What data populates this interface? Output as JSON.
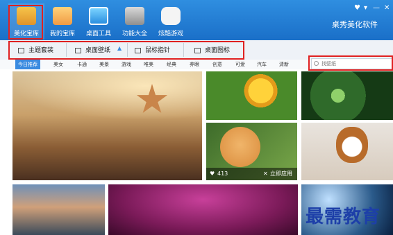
{
  "nav": [
    {
      "label": "美化宝库",
      "icon": "treasure-chest-icon",
      "active": true
    },
    {
      "label": "我的宝库",
      "icon": "store-icon"
    },
    {
      "label": "桌面工具",
      "icon": "desktop-tools-icon"
    },
    {
      "label": "功能大全",
      "icon": "toolbox-icon"
    },
    {
      "label": "炫酷游戏",
      "icon": "gamepad-icon"
    }
  ],
  "brand": "桌秀美化软件",
  "window_controls": [
    "♥",
    "▾",
    "—",
    "✕"
  ],
  "subtabs": [
    {
      "label": "主题套装",
      "icon": "theme-icon"
    },
    {
      "label": "桌面壁纸",
      "icon": "wallpaper-icon"
    },
    {
      "label": "鼠标指针",
      "icon": "cursor-icon"
    },
    {
      "label": "桌面图标",
      "icon": "monitor-icon"
    }
  ],
  "categories": [
    "今日推荐",
    "美女",
    "卡通",
    "美景",
    "游戏",
    "唯美",
    "经典",
    "养眼",
    "创意",
    "可爱",
    "汽车",
    "清新"
  ],
  "search": {
    "placeholder": "找壁纸"
  },
  "tile": {
    "likes": "413",
    "apply": "立即应用"
  },
  "watermark": "最需教育"
}
